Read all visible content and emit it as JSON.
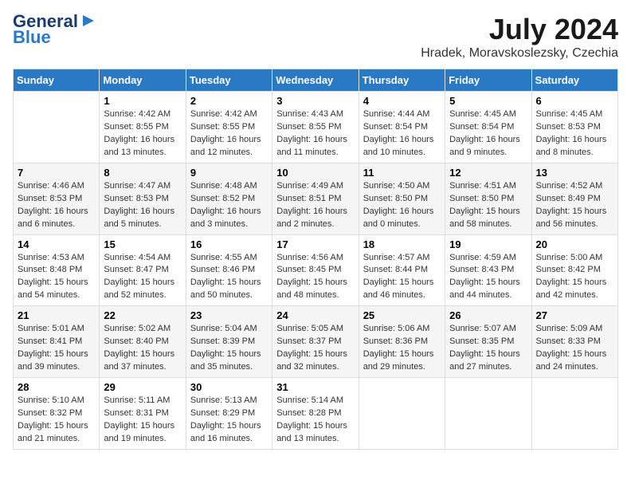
{
  "logo": {
    "line1": "General",
    "line2": "Blue"
  },
  "header": {
    "month_year": "July 2024",
    "location": "Hradek, Moravskoslezsky, Czechia"
  },
  "weekdays": [
    "Sunday",
    "Monday",
    "Tuesday",
    "Wednesday",
    "Thursday",
    "Friday",
    "Saturday"
  ],
  "weeks": [
    [
      {
        "day": null,
        "info": null
      },
      {
        "day": "1",
        "info": "Sunrise: 4:42 AM\nSunset: 8:55 PM\nDaylight: 16 hours\nand 13 minutes."
      },
      {
        "day": "2",
        "info": "Sunrise: 4:42 AM\nSunset: 8:55 PM\nDaylight: 16 hours\nand 12 minutes."
      },
      {
        "day": "3",
        "info": "Sunrise: 4:43 AM\nSunset: 8:55 PM\nDaylight: 16 hours\nand 11 minutes."
      },
      {
        "day": "4",
        "info": "Sunrise: 4:44 AM\nSunset: 8:54 PM\nDaylight: 16 hours\nand 10 minutes."
      },
      {
        "day": "5",
        "info": "Sunrise: 4:45 AM\nSunset: 8:54 PM\nDaylight: 16 hours\nand 9 minutes."
      },
      {
        "day": "6",
        "info": "Sunrise: 4:45 AM\nSunset: 8:53 PM\nDaylight: 16 hours\nand 8 minutes."
      }
    ],
    [
      {
        "day": "7",
        "info": "Sunrise: 4:46 AM\nSunset: 8:53 PM\nDaylight: 16 hours\nand 6 minutes."
      },
      {
        "day": "8",
        "info": "Sunrise: 4:47 AM\nSunset: 8:53 PM\nDaylight: 16 hours\nand 5 minutes."
      },
      {
        "day": "9",
        "info": "Sunrise: 4:48 AM\nSunset: 8:52 PM\nDaylight: 16 hours\nand 3 minutes."
      },
      {
        "day": "10",
        "info": "Sunrise: 4:49 AM\nSunset: 8:51 PM\nDaylight: 16 hours\nand 2 minutes."
      },
      {
        "day": "11",
        "info": "Sunrise: 4:50 AM\nSunset: 8:50 PM\nDaylight: 16 hours\nand 0 minutes."
      },
      {
        "day": "12",
        "info": "Sunrise: 4:51 AM\nSunset: 8:50 PM\nDaylight: 15 hours\nand 58 minutes."
      },
      {
        "day": "13",
        "info": "Sunrise: 4:52 AM\nSunset: 8:49 PM\nDaylight: 15 hours\nand 56 minutes."
      }
    ],
    [
      {
        "day": "14",
        "info": "Sunrise: 4:53 AM\nSunset: 8:48 PM\nDaylight: 15 hours\nand 54 minutes."
      },
      {
        "day": "15",
        "info": "Sunrise: 4:54 AM\nSunset: 8:47 PM\nDaylight: 15 hours\nand 52 minutes."
      },
      {
        "day": "16",
        "info": "Sunrise: 4:55 AM\nSunset: 8:46 PM\nDaylight: 15 hours\nand 50 minutes."
      },
      {
        "day": "17",
        "info": "Sunrise: 4:56 AM\nSunset: 8:45 PM\nDaylight: 15 hours\nand 48 minutes."
      },
      {
        "day": "18",
        "info": "Sunrise: 4:57 AM\nSunset: 8:44 PM\nDaylight: 15 hours\nand 46 minutes."
      },
      {
        "day": "19",
        "info": "Sunrise: 4:59 AM\nSunset: 8:43 PM\nDaylight: 15 hours\nand 44 minutes."
      },
      {
        "day": "20",
        "info": "Sunrise: 5:00 AM\nSunset: 8:42 PM\nDaylight: 15 hours\nand 42 minutes."
      }
    ],
    [
      {
        "day": "21",
        "info": "Sunrise: 5:01 AM\nSunset: 8:41 PM\nDaylight: 15 hours\nand 39 minutes."
      },
      {
        "day": "22",
        "info": "Sunrise: 5:02 AM\nSunset: 8:40 PM\nDaylight: 15 hours\nand 37 minutes."
      },
      {
        "day": "23",
        "info": "Sunrise: 5:04 AM\nSunset: 8:39 PM\nDaylight: 15 hours\nand 35 minutes."
      },
      {
        "day": "24",
        "info": "Sunrise: 5:05 AM\nSunset: 8:37 PM\nDaylight: 15 hours\nand 32 minutes."
      },
      {
        "day": "25",
        "info": "Sunrise: 5:06 AM\nSunset: 8:36 PM\nDaylight: 15 hours\nand 29 minutes."
      },
      {
        "day": "26",
        "info": "Sunrise: 5:07 AM\nSunset: 8:35 PM\nDaylight: 15 hours\nand 27 minutes."
      },
      {
        "day": "27",
        "info": "Sunrise: 5:09 AM\nSunset: 8:33 PM\nDaylight: 15 hours\nand 24 minutes."
      }
    ],
    [
      {
        "day": "28",
        "info": "Sunrise: 5:10 AM\nSunset: 8:32 PM\nDaylight: 15 hours\nand 21 minutes."
      },
      {
        "day": "29",
        "info": "Sunrise: 5:11 AM\nSunset: 8:31 PM\nDaylight: 15 hours\nand 19 minutes."
      },
      {
        "day": "30",
        "info": "Sunrise: 5:13 AM\nSunset: 8:29 PM\nDaylight: 15 hours\nand 16 minutes."
      },
      {
        "day": "31",
        "info": "Sunrise: 5:14 AM\nSunset: 8:28 PM\nDaylight: 15 hours\nand 13 minutes."
      },
      {
        "day": null,
        "info": null
      },
      {
        "day": null,
        "info": null
      },
      {
        "day": null,
        "info": null
      }
    ]
  ]
}
